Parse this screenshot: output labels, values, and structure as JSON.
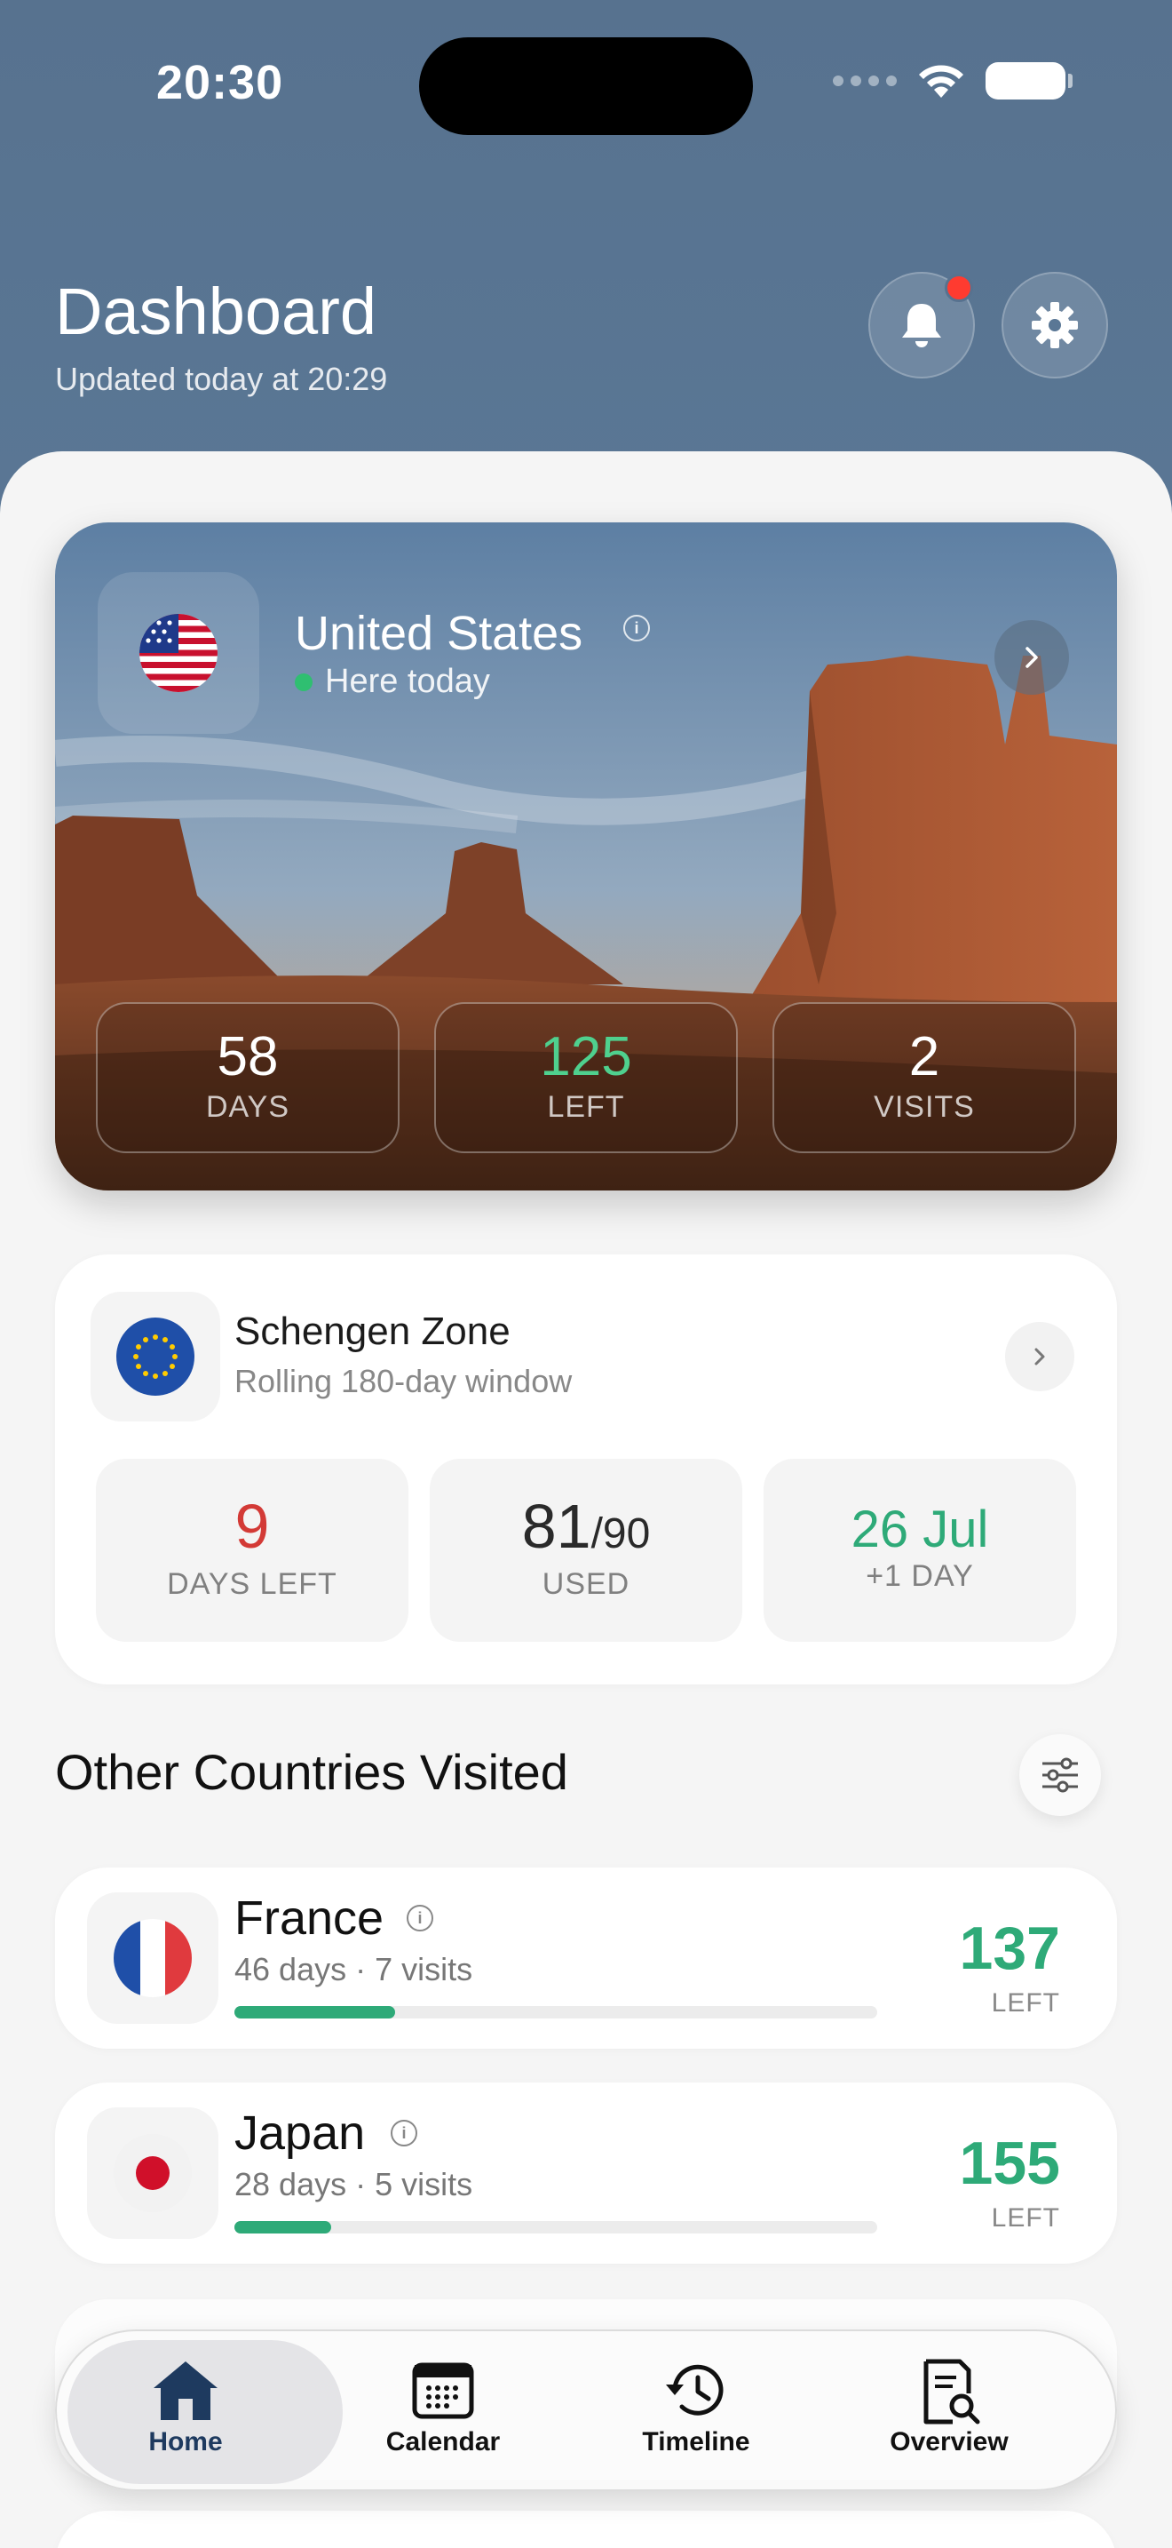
{
  "status_bar": {
    "time": "20:30"
  },
  "header": {
    "title": "Dashboard",
    "subtitle": "Updated today at 20:29",
    "bell_icon": "bell-icon",
    "settings_icon": "gear-icon",
    "has_notification": true
  },
  "current_country": {
    "name": "United States",
    "status": "Here today",
    "flag": "us-flag",
    "stats": [
      {
        "value": "58",
        "label": "DAYS"
      },
      {
        "value": "125",
        "label": "LEFT"
      },
      {
        "value": "2",
        "label": "VISITS"
      }
    ]
  },
  "schengen": {
    "title": "Schengen Zone",
    "subtitle": "Rolling 180-day window",
    "flag": "eu-flag",
    "days_left": {
      "value": "9",
      "label": "DAYS LEFT"
    },
    "used": {
      "value": "81",
      "total": "/90",
      "label": "USED"
    },
    "next": {
      "value": "26 Jul",
      "label": "+1 DAY"
    }
  },
  "other_countries": {
    "title": "Other Countries Visited",
    "filter_icon": "sliders-icon",
    "items": [
      {
        "name": "France",
        "meta": "46 days · 7 visits",
        "left": "137",
        "left_label": "LEFT",
        "progress": 0.25,
        "flag": "fr-flag"
      },
      {
        "name": "Japan",
        "meta": "28 days · 5 visits",
        "left": "155",
        "left_label": "LEFT",
        "progress": 0.15,
        "flag": "jp-flag"
      }
    ]
  },
  "tabbar": {
    "items": [
      {
        "label": "Home",
        "icon": "house-icon",
        "active": true
      },
      {
        "label": "Calendar",
        "icon": "calendar-icon",
        "active": false
      },
      {
        "label": "Timeline",
        "icon": "history-icon",
        "active": false
      },
      {
        "label": "Overview",
        "icon": "document-search-icon",
        "active": false
      }
    ]
  },
  "colors": {
    "header": "#57728f",
    "accent_green": "#2eaa78",
    "warning_red": "#d33a36",
    "active_tab": "#1e3a5f"
  }
}
